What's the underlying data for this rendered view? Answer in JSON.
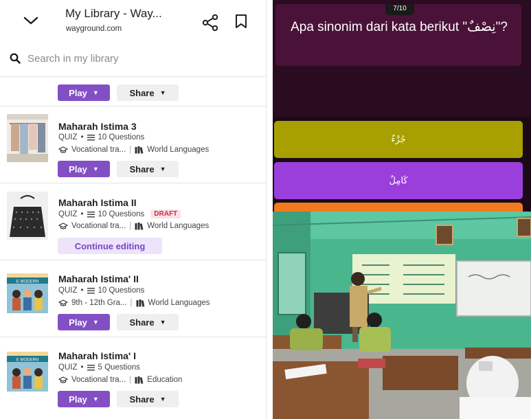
{
  "browser": {
    "title": "My Library - Way...",
    "domain": "wayground.com",
    "icons": [
      "chevron-down-icon",
      "share-icon",
      "bookmark-icon"
    ]
  },
  "search": {
    "placeholder": "Search in my library"
  },
  "labels": {
    "play": "Play",
    "share": "Share",
    "continue_editing": "Continue editing"
  },
  "items": [
    {
      "title": "Maharah Istima 3",
      "type": "QUIZ",
      "questions": "10 Questions",
      "grade": "Vocational tra...",
      "subject": "World Languages",
      "status": "",
      "action": "play"
    },
    {
      "title": "Maharah Istima II",
      "type": "QUIZ",
      "questions": "10 Questions",
      "grade": "Vocational tra...",
      "subject": "World Languages",
      "status": "DRAFT",
      "action": "continue_editing"
    },
    {
      "title": "Maharah Istima' II",
      "type": "QUIZ",
      "questions": "10 Questions",
      "grade": "9th - 12th Gra...",
      "subject": "World Languages",
      "status": "",
      "action": "play"
    },
    {
      "title": "Maharah Istima' I",
      "type": "QUIZ",
      "questions": "5 Questions",
      "grade": "Vocational tra...",
      "subject": "Education",
      "status": "",
      "action": "play"
    }
  ],
  "quiz": {
    "counter": "7/10",
    "question": "Apa sinonim dari kata berikut \"نِصْفٌ\"?",
    "options": [
      "جُزْءٌ",
      "كَامِلٌ"
    ]
  },
  "colors": {
    "play": "#8250c4",
    "option1": "#a8a000",
    "option2": "#9b3fdc",
    "option3": "#f07a20",
    "draft": "#c0334d"
  }
}
